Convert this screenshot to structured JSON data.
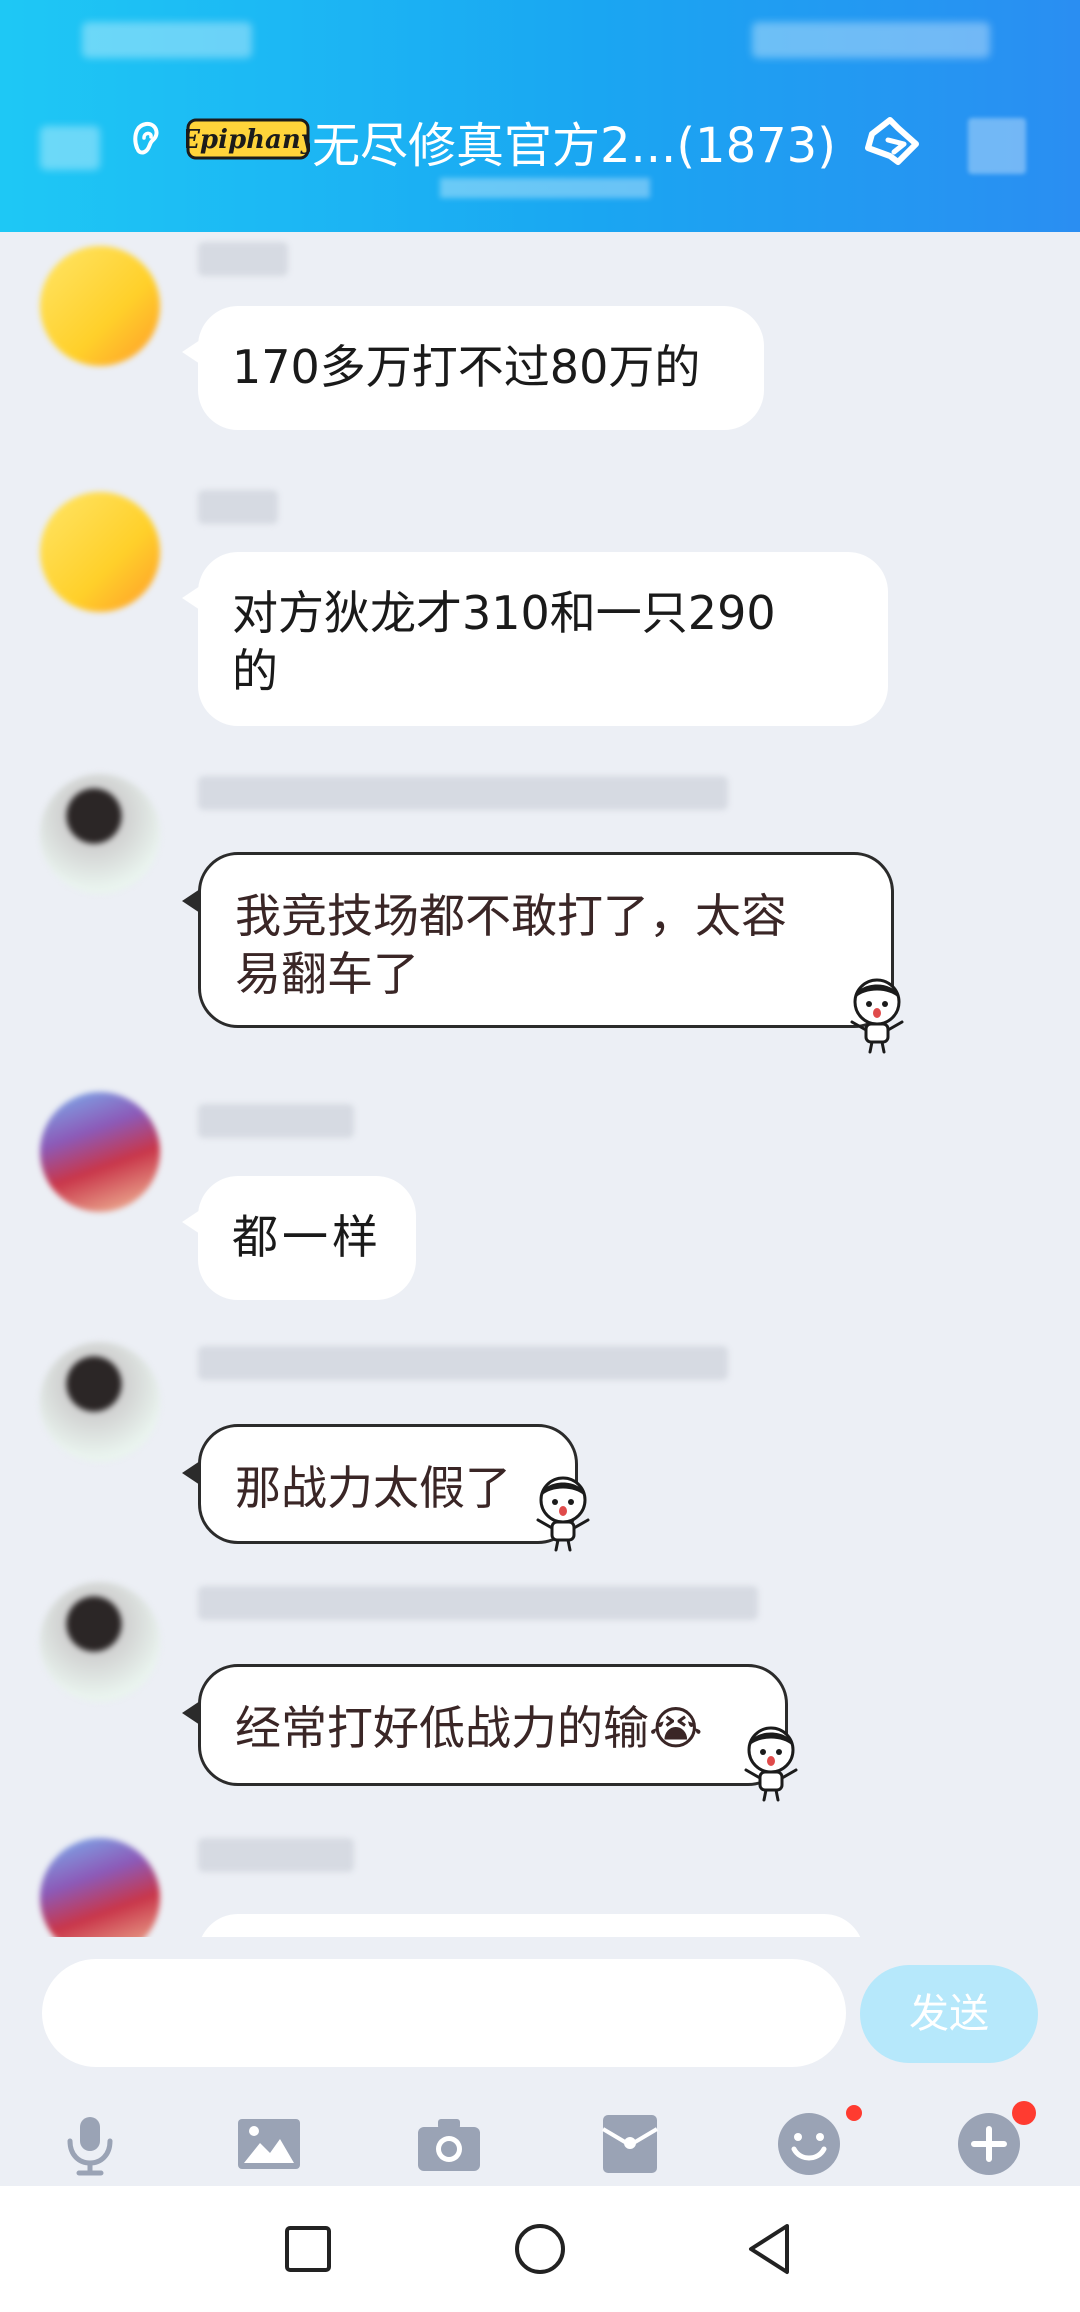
{
  "header": {
    "brand_logo_text": "Epiphany",
    "group_title": "无尽修真官方2...(1873)"
  },
  "messages": [
    {
      "text": "170多万打不过80万的"
    },
    {
      "text": "对方狄龙才310和一只290\n的"
    },
    {
      "text": "我竞技场都不敢打了，太容\n易翻车了"
    },
    {
      "text": "都一样"
    },
    {
      "text": "那战力太假了"
    },
    {
      "text": "经常打好低战力的输😭"
    }
  ],
  "input": {
    "value": "",
    "placeholder": "",
    "send_label": "发送"
  },
  "toolbar": {
    "icons": [
      "microphone-icon",
      "image-icon",
      "camera-icon",
      "red-packet-icon",
      "emoji-icon",
      "plus-icon"
    ]
  },
  "nav": {
    "icons": [
      "recent-apps-icon",
      "home-icon",
      "back-icon"
    ]
  },
  "colors": {
    "header_start": "#1ec8f5",
    "header_end": "#2a8ef2",
    "chat_bg": "#eceff5",
    "send_button": "#b6e8fb",
    "badge_red": "#ff3b30"
  }
}
